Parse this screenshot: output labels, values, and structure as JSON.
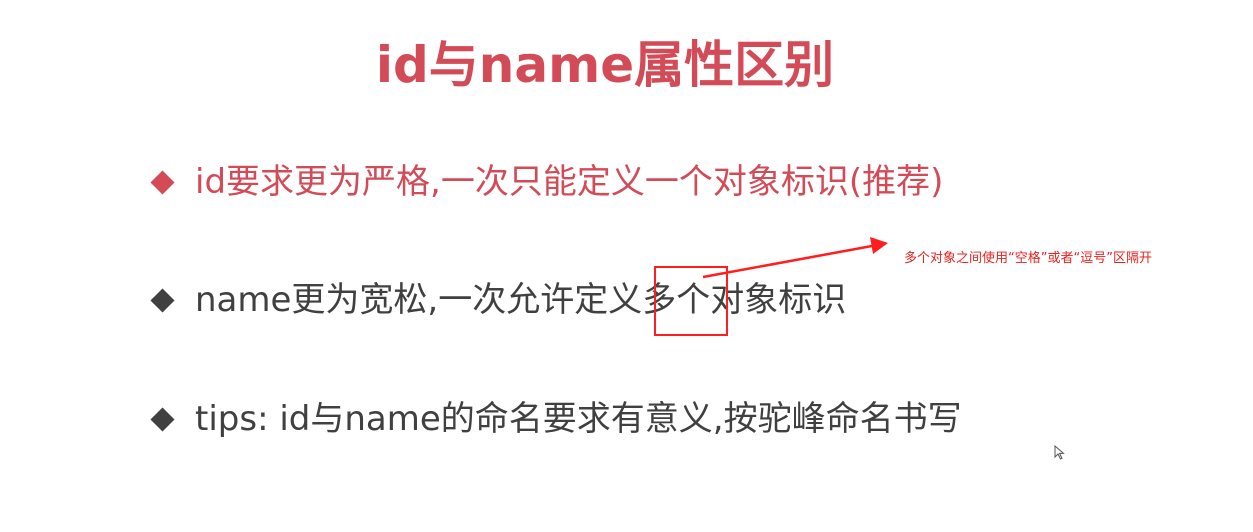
{
  "title": "id与name属性区别",
  "bullets": [
    {
      "text": "id要求更为严格,一次只能定义一个对象标识(推荐)"
    },
    {
      "text": "name更为宽松,一次允许定义多个对象标识"
    },
    {
      "text": "tips: id与name的命名要求有意义,按驼峰命名书写"
    }
  ],
  "annotation": {
    "text": "多个对象之间使用“空格”或者“逗号”区隔开"
  },
  "colors": {
    "accent": "#d24b57",
    "body_text": "#404040",
    "annotation_red": "#e8221e"
  },
  "icons": {
    "bullet": "diamond-bullet-icon",
    "cursor": "mouse-cursor-icon",
    "arrow": "annotation-arrow-icon"
  }
}
